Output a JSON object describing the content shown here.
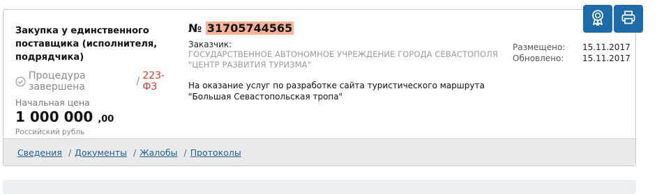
{
  "procurement": {
    "type_label": "Закупка у единственного поставщика (исполнителя, подрядчика)",
    "status": "Процедура завершена",
    "status_separator": "/",
    "law": "223-ФЗ",
    "price_label": "Начальная цена",
    "price_main": "1 000 000",
    "price_cents": ",00",
    "currency": "Российский рубль",
    "number_prefix": "№",
    "number": "31705744565",
    "customer_label": "Заказчик:",
    "customer_name": "ГОСУДАРСТВЕННОЕ АВТОНОМНОЕ УЧРЕЖДЕНИЕ ГОРОДА СЕВАСТОПОЛЯ \"ЦЕНТР РАЗВИТИЯ ТУРИЗМА\"",
    "subject": "На оказание услуг по разработке сайта туристического маршрута \"Большая Севастопольская тропа\""
  },
  "dates": {
    "placed_label": "Размещено:",
    "placed_value": "15.11.2017",
    "updated_label": "Обновлено:",
    "updated_value": "15.11.2017"
  },
  "nav": {
    "items": [
      "Сведения",
      "Документы",
      "Жалобы",
      "Протоколы"
    ],
    "separator": "/"
  },
  "actions": {
    "certificate_icon": "certificate-icon",
    "print_icon": "printer-icon"
  },
  "colors": {
    "accent": "#1f6aa8",
    "highlight": "#f7b29a",
    "law": "#d63b2a"
  }
}
